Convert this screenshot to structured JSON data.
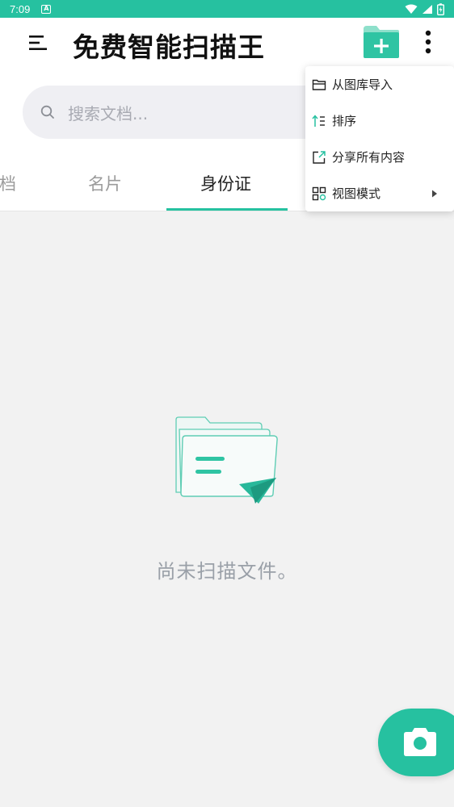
{
  "status_bar": {
    "time": "7:09",
    "a_badge": "A"
  },
  "app": {
    "title": "免费智能扫描王"
  },
  "search": {
    "placeholder": "搜索文档..."
  },
  "tabs": [
    {
      "label": "文档",
      "active": false
    },
    {
      "label": "名片",
      "active": false
    },
    {
      "label": "身份证",
      "active": true
    }
  ],
  "empty_state": {
    "message": "尚未扫描文件。"
  },
  "menu": {
    "items": [
      {
        "label": "从图库导入",
        "icon": "folder-open-icon"
      },
      {
        "label": "排序",
        "icon": "sort-icon"
      },
      {
        "label": "分享所有内容",
        "icon": "share-external-icon"
      },
      {
        "label": "视图模式",
        "icon": "grid-view-icon",
        "has_submenu": true
      }
    ]
  },
  "colors": {
    "accent": "#26c1a0",
    "background": "#f2f2f2",
    "text_muted": "#9aa0a8"
  }
}
